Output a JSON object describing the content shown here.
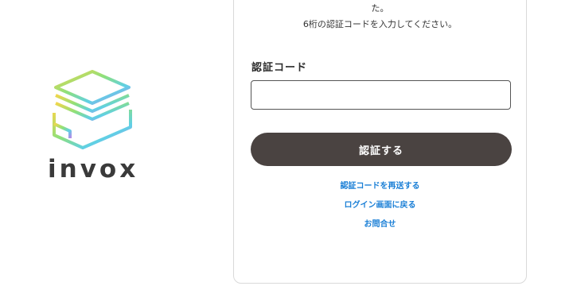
{
  "brand": {
    "name": "invox",
    "logo_icon": "stacked-layers-logo-icon"
  },
  "message": {
    "line1": "た。",
    "line2": "6桁の認証コードを入力してください。"
  },
  "form": {
    "code_label": "認証コード",
    "code_value": "",
    "submit_label": "認証する"
  },
  "links": {
    "resend": "認証コードを再送する",
    "back_to_login": "ログイン画面に戻る",
    "contact": "お問合せ"
  },
  "colors": {
    "button_bg": "#4a4341",
    "link": "#1a7fd6",
    "logo_gradient": [
      "#f2d64b",
      "#8fe07a",
      "#5fd0e6",
      "#b48be8"
    ]
  }
}
